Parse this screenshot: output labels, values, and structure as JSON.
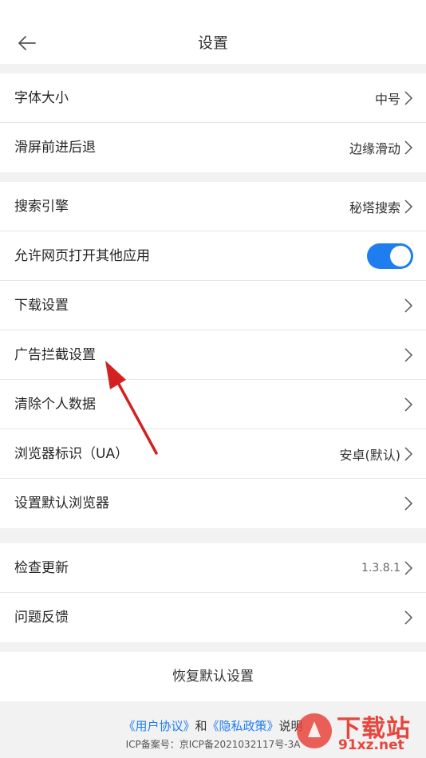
{
  "header": {
    "title": "设置",
    "back_icon": "arrow-left-icon"
  },
  "group1": [
    {
      "label": "字体大小",
      "value": "中号"
    },
    {
      "label": "滑屏前进后退",
      "value": "边缘滑动"
    }
  ],
  "group2": [
    {
      "label": "搜索引擎",
      "value": "秘塔搜索"
    },
    {
      "label": "允许网页打开其他应用",
      "toggle_on": true
    },
    {
      "label": "下载设置"
    },
    {
      "label": "广告拦截设置"
    },
    {
      "label": "清除个人数据"
    },
    {
      "label": "浏览器标识（UA）",
      "value": "安卓(默认)"
    },
    {
      "label": "设置默认浏览器"
    }
  ],
  "group3": [
    {
      "label": "检查更新",
      "value": "1.3.8.1"
    },
    {
      "label": "问题反馈"
    }
  ],
  "reset_label": "恢复默认设置",
  "footer": {
    "user_agreement": "《用户协议》",
    "and": "和",
    "privacy_policy": "《隐私政策》",
    "explain": "说明",
    "icp": "ICP备案号：京ICP备2021032117号-3A"
  },
  "watermark": {
    "text": "下载站",
    "domain": "91xz.net"
  },
  "colors": {
    "accent": "#1e7ef0",
    "annotation_arrow": "#d32020",
    "background": "#f2f2f2"
  }
}
